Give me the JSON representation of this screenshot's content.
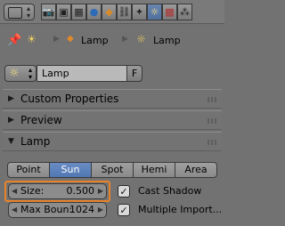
{
  "breadcrumb": {
    "first": "Lamp",
    "second": "Lamp"
  },
  "datablock": {
    "name": "Lamp",
    "fake_user": "F"
  },
  "panels": [
    {
      "label": "Custom Properties",
      "expanded": false
    },
    {
      "label": "Preview",
      "expanded": false
    },
    {
      "label": "Lamp",
      "expanded": true
    }
  ],
  "lamp_types": [
    "Point",
    "Sun",
    "Spot",
    "Hemi",
    "Area"
  ],
  "active_lamp_type": "Sun",
  "size": {
    "label": "Size:",
    "value": "0.500"
  },
  "max_bounces": {
    "label": "Max Boun:",
    "value": "1024"
  },
  "cast_shadow": {
    "label": "Cast Shadow",
    "checked": true
  },
  "multiple_importance": {
    "label": "Multiple Import...",
    "checked": true
  },
  "icons": {
    "editor_type": "properties-editor-icon",
    "pin": "pin-icon",
    "contexts": [
      "render-icon",
      "scene-icon",
      "world-icon",
      "object-icon",
      "constraints-icon",
      "modifiers-icon",
      "data-icon",
      "material-icon",
      "texture-icon"
    ]
  },
  "colors": {
    "accent_blue": "#5078b3",
    "highlight_orange": "#e8822a",
    "background": "#727272"
  }
}
